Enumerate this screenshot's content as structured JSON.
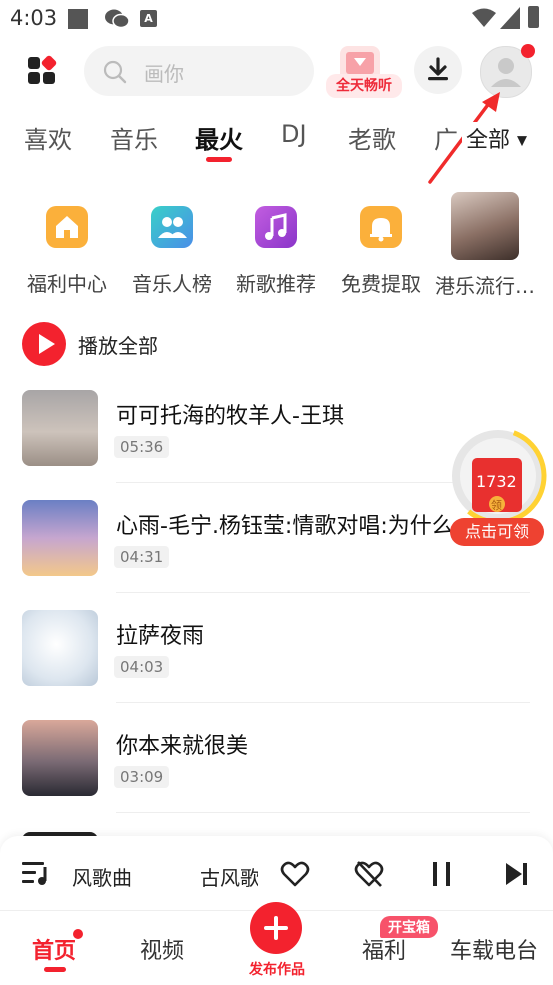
{
  "status_bar": {
    "time": "4:03",
    "app_icon_a": "A"
  },
  "header": {
    "search_placeholder": "画你",
    "allday_label": "全天畅听"
  },
  "tabs": [
    "喜欢",
    "音乐",
    "最火",
    "DJ",
    "老歌",
    "广"
  ],
  "active_tab": "最火",
  "tab_all": "全部",
  "quick_grid": [
    {
      "label": "福利中心",
      "icon": "home-icon",
      "color": "#fbb03b"
    },
    {
      "label": "音乐人榜",
      "icon": "people-icon",
      "color": "#3aa7e8"
    },
    {
      "label": "新歌推荐",
      "icon": "music-note-icon",
      "color": "#b047d9"
    },
    {
      "label": "免费提取",
      "icon": "bell-icon",
      "color": "#fbb03b"
    },
    {
      "label": "港乐流行…",
      "icon": "photo-thumbnail",
      "color": "#8a6f64"
    }
  ],
  "play_all": "播放全部",
  "songs": [
    {
      "title": "可可托海的牧羊人-王琪",
      "duration": "05:36"
    },
    {
      "title": "心雨-毛宁.杨钰莹:情歌对唱:为什么",
      "duration": "04:31"
    },
    {
      "title": "拉萨夜雨",
      "duration": "04:03"
    },
    {
      "title": "你本来就很美",
      "duration": "03:09"
    }
  ],
  "reward": {
    "amount": "1732",
    "coin_label": "领",
    "cta": "点击可领"
  },
  "player": {
    "song": "风歌曲",
    "next_song": "古风歌"
  },
  "bottom_nav": {
    "home": "首页",
    "video": "视频",
    "publish": "发布作品",
    "welfare": "福利",
    "welfare_badge": "开宝箱",
    "car": "车载电台"
  },
  "colors": {
    "accent": "#f3222e",
    "arrow": "#f02b2b"
  }
}
